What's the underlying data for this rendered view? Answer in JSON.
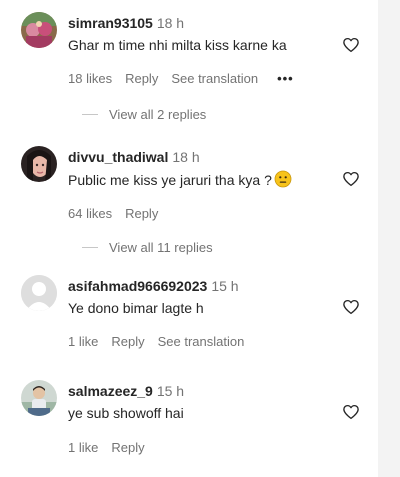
{
  "comments": [
    {
      "username": "simran93105",
      "time": "18 h",
      "text": "Ghar m time nhi milta kiss karne ka",
      "likes": "18 likes",
      "reply": "Reply",
      "translation": "See translation",
      "more": "•••",
      "view_replies": "View all 2 replies"
    },
    {
      "username": "divvu_thadiwal",
      "time": "18 h",
      "text": "Public me kiss ye jaruri tha kya ?",
      "emoji": "neutral-face-emoji",
      "likes": "64 likes",
      "reply": "Reply",
      "view_replies": "View all 11 replies"
    },
    {
      "username": "asifahmad966692023",
      "time": "15 h",
      "text": "Ye dono bimar lagte h",
      "likes": "1 like",
      "reply": "Reply",
      "translation": "See translation"
    },
    {
      "username": "salmazeez_9",
      "time": "15 h",
      "text": "ye sub showoff hai",
      "likes": "1 like",
      "reply": "Reply"
    }
  ],
  "colors": {
    "text": "#262626",
    "secondary": "#737373",
    "emoji_yellow": "#f7c31b"
  }
}
